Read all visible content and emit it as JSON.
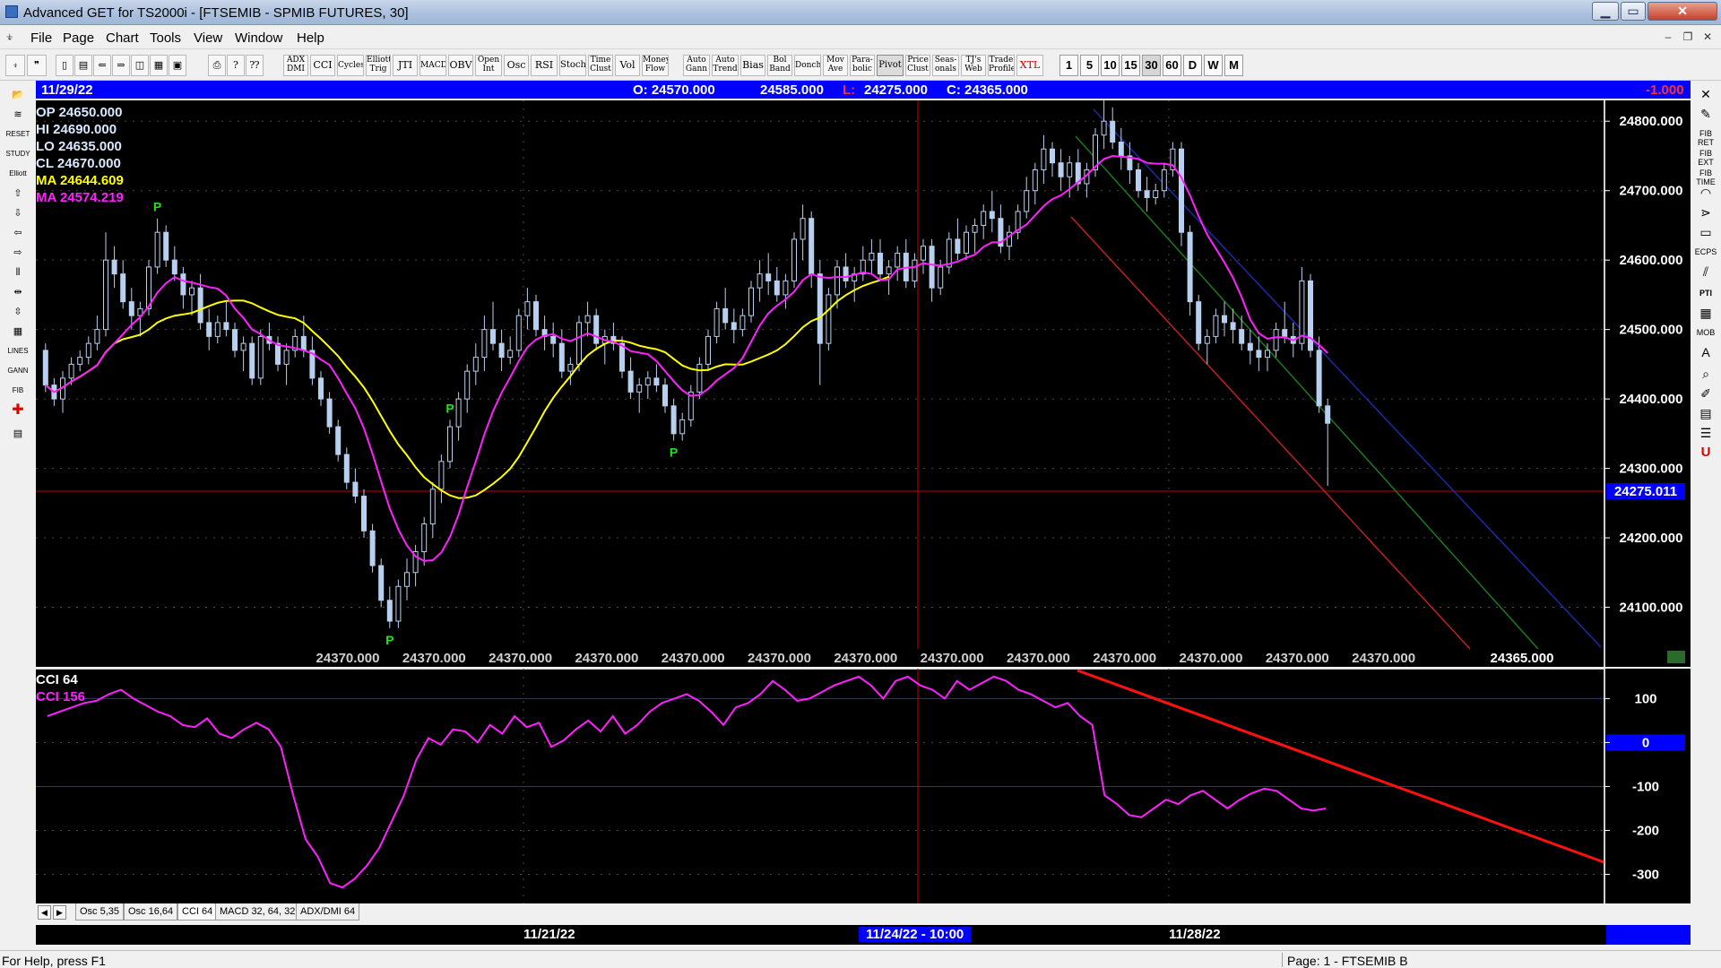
{
  "window": {
    "title": "Advanced GET for TS2000i - [FTSEMIB - SPMIB FUTURES, 30]",
    "min_glyph": "▁",
    "max_glyph": "▭",
    "close_glyph": "✕"
  },
  "menu": {
    "items": [
      "File",
      "Page",
      "Chart",
      "Tools",
      "View",
      "Window",
      "Help"
    ],
    "mdi_min": "‒",
    "mdi_restore": "❐",
    "mdi_close": "✕"
  },
  "toolbar": {
    "studies": [
      {
        "label": "ADX DMI"
      },
      {
        "label": "CCI"
      },
      {
        "label": "Cycles"
      },
      {
        "label": "Elliott Trig"
      },
      {
        "label": "JTI"
      },
      {
        "label": "MACD"
      },
      {
        "label": "OBV"
      },
      {
        "label": "Open Int"
      },
      {
        "label": "Osc"
      },
      {
        "label": "RSI"
      },
      {
        "label": "Stoch"
      },
      {
        "label": "Time Clust"
      },
      {
        "label": "Vol"
      },
      {
        "label": "Money Flow"
      }
    ],
    "studies2": [
      {
        "label": "Auto Gann"
      },
      {
        "label": "Auto Trend"
      },
      {
        "label": "Bias"
      },
      {
        "label": "Bol Band"
      },
      {
        "label": "Donch"
      },
      {
        "label": "Mov Ave"
      },
      {
        "label": "Para-bolic"
      },
      {
        "label": "Pivot"
      },
      {
        "label": "Price Clust"
      },
      {
        "label": "Seas-onals"
      },
      {
        "label": "TJ's Web"
      },
      {
        "label": "Trade Profile"
      },
      {
        "label": "XTL"
      }
    ],
    "timeframes": [
      "1",
      "5",
      "10",
      "15",
      "30",
      "60",
      "D",
      "W",
      "M"
    ],
    "selected_timeframe": "30"
  },
  "header_bar": {
    "date": "11/29/22",
    "open": "O: 24570.000",
    "high": "24585.000",
    "low_label": "L:",
    "low": "24275.000",
    "close": "C: 24365.000",
    "change": "-1.000"
  },
  "price_panel": {
    "readout": {
      "op": "OP  24650.000",
      "hi": "HI   24690.000",
      "lo": "LO  24635.000",
      "cl": "CL  24670.000",
      "ma1": "MA  24644.609",
      "ma2": "MA  24574.219"
    },
    "axis_labels": [
      "24800.000",
      "24700.000",
      "24600.000",
      "24500.000",
      "24400.000",
      "24300.000",
      "24200.000",
      "24100.000"
    ],
    "current_price": "24275.011",
    "bottom_values": [
      "24370.000",
      "24370.000",
      "24370.000",
      "24370.000",
      "24370.000",
      "24370.000",
      "24370.000",
      "24370.000",
      "24370.000",
      "24370.000",
      "24370.000",
      "24370.000",
      "24370.000"
    ],
    "bottom_last": "24365.000",
    "pivot_marker": "P"
  },
  "cci_panel": {
    "title": "CCI 64",
    "value_label": "CCI  156",
    "axis_labels": [
      "100",
      "0",
      "-100",
      "-200",
      "-300"
    ]
  },
  "tabs": [
    "Osc 5,35",
    "Osc 16,64",
    "CCI 64",
    "MACD 32, 64, 32",
    "ADX/DMI 64"
  ],
  "selected_tab": "CCI 64",
  "time_axis": {
    "labels": [
      "11/21/22",
      "11/24/22 - 10:00",
      "11/28/22"
    ]
  },
  "status": {
    "help": "For Help, press F1",
    "page": "Page: 1 - FTSEMIB B"
  },
  "chart_data": [
    {
      "type": "candlestick",
      "ylim": [
        24040,
        24830
      ],
      "bars": [
        [
          24470,
          24480,
          24410,
          24420
        ],
        [
          24420,
          24430,
          24390,
          24400
        ],
        [
          24400,
          24440,
          24380,
          24430
        ],
        [
          24430,
          24460,
          24420,
          24450
        ],
        [
          24450,
          24470,
          24440,
          24460
        ],
        [
          24460,
          24490,
          24450,
          24480
        ],
        [
          24480,
          24520,
          24470,
          24500
        ],
        [
          24500,
          24640,
          24490,
          24600
        ],
        [
          24600,
          24620,
          24560,
          24580
        ],
        [
          24580,
          24600,
          24530,
          24540
        ],
        [
          24540,
          24560,
          24500,
          24520
        ],
        [
          24520,
          24540,
          24490,
          24530
        ],
        [
          24530,
          24600,
          24520,
          24590
        ],
        [
          24590,
          24660,
          24580,
          24640
        ],
        [
          24640,
          24650,
          24590,
          24600
        ],
        [
          24600,
          24620,
          24570,
          24580
        ],
        [
          24580,
          24590,
          24530,
          24550
        ],
        [
          24550,
          24570,
          24520,
          24560
        ],
        [
          24560,
          24580,
          24500,
          24510
        ],
        [
          24510,
          24530,
          24470,
          24490
        ],
        [
          24490,
          24520,
          24480,
          24510
        ],
        [
          24510,
          24540,
          24490,
          24500
        ],
        [
          24500,
          24510,
          24460,
          24470
        ],
        [
          24470,
          24490,
          24440,
          24480
        ],
        [
          24480,
          24490,
          24420,
          24430
        ],
        [
          24430,
          24500,
          24420,
          24490
        ],
        [
          24490,
          24510,
          24470,
          24480
        ],
        [
          24480,
          24490,
          24440,
          24450
        ],
        [
          24450,
          24480,
          24420,
          24470
        ],
        [
          24470,
          24500,
          24460,
          24490
        ],
        [
          24490,
          24520,
          24460,
          24470
        ],
        [
          24470,
          24490,
          24420,
          24430
        ],
        [
          24430,
          24440,
          24390,
          24400
        ],
        [
          24400,
          24410,
          24350,
          24360
        ],
        [
          24360,
          24370,
          24310,
          24320
        ],
        [
          24320,
          24330,
          24270,
          24280
        ],
        [
          24280,
          24300,
          24250,
          24260
        ],
        [
          24260,
          24270,
          24200,
          24210
        ],
        [
          24210,
          24220,
          24150,
          24160
        ],
        [
          24160,
          24170,
          24100,
          24110
        ],
        [
          24110,
          24130,
          24070,
          24080
        ],
        [
          24080,
          24140,
          24070,
          24130
        ],
        [
          24130,
          24170,
          24110,
          24150
        ],
        [
          24150,
          24190,
          24130,
          24180
        ],
        [
          24180,
          24230,
          24160,
          24220
        ],
        [
          24220,
          24280,
          24200,
          24270
        ],
        [
          24270,
          24320,
          24250,
          24310
        ],
        [
          24310,
          24370,
          24300,
          24360
        ],
        [
          24360,
          24410,
          24340,
          24400
        ],
        [
          24400,
          24450,
          24380,
          24440
        ],
        [
          24440,
          24480,
          24420,
          24460
        ],
        [
          24460,
          24520,
          24440,
          24500
        ],
        [
          24500,
          24540,
          24470,
          24480
        ],
        [
          24480,
          24500,
          24440,
          24460
        ],
        [
          24460,
          24490,
          24450,
          24470
        ],
        [
          24470,
          24530,
          24460,
          24520
        ],
        [
          24520,
          24560,
          24500,
          24540
        ],
        [
          24540,
          24550,
          24490,
          24500
        ],
        [
          24500,
          24520,
          24470,
          24490
        ],
        [
          24490,
          24510,
          24460,
          24480
        ],
        [
          24480,
          24500,
          24430,
          24440
        ],
        [
          24440,
          24460,
          24420,
          24450
        ],
        [
          24450,
          24520,
          24440,
          24510
        ],
        [
          24510,
          24540,
          24490,
          24520
        ],
        [
          24520,
          24530,
          24470,
          24480
        ],
        [
          24480,
          24500,
          24450,
          24490
        ],
        [
          24490,
          24510,
          24470,
          24480
        ],
        [
          24480,
          24490,
          24430,
          24440
        ],
        [
          24440,
          24460,
          24400,
          24410
        ],
        [
          24410,
          24430,
          24380,
          24420
        ],
        [
          24420,
          24440,
          24400,
          24430
        ],
        [
          24430,
          24450,
          24410,
          24420
        ],
        [
          24420,
          24430,
          24380,
          24390
        ],
        [
          24390,
          24400,
          24340,
          24350
        ],
        [
          24350,
          24380,
          24340,
          24370
        ],
        [
          24370,
          24420,
          24360,
          24410
        ],
        [
          24410,
          24460,
          24400,
          24450
        ],
        [
          24450,
          24500,
          24440,
          24490
        ],
        [
          24490,
          24540,
          24480,
          24530
        ],
        [
          24530,
          24560,
          24500,
          24510
        ],
        [
          24510,
          24530,
          24480,
          24500
        ],
        [
          24500,
          24530,
          24490,
          24520
        ],
        [
          24520,
          24570,
          24510,
          24560
        ],
        [
          24560,
          24600,
          24540,
          24580
        ],
        [
          24580,
          24610,
          24550,
          24570
        ],
        [
          24570,
          24590,
          24540,
          24550
        ],
        [
          24550,
          24580,
          24530,
          24570
        ],
        [
          24570,
          24640,
          24560,
          24630
        ],
        [
          24630,
          24680,
          24600,
          24660
        ],
        [
          24660,
          24670,
          24560,
          24580
        ],
        [
          24580,
          24600,
          24420,
          24480
        ],
        [
          24480,
          24560,
          24470,
          24550
        ],
        [
          24550,
          24600,
          24530,
          24590
        ],
        [
          24590,
          24610,
          24560,
          24570
        ],
        [
          24570,
          24590,
          24540,
          24580
        ],
        [
          24580,
          24620,
          24570,
          24600
        ],
        [
          24600,
          24630,
          24580,
          24610
        ],
        [
          24610,
          24630,
          24570,
          24580
        ],
        [
          24580,
          24600,
          24550,
          24590
        ],
        [
          24590,
          24620,
          24570,
          24610
        ],
        [
          24610,
          24630,
          24560,
          24570
        ],
        [
          24570,
          24610,
          24560,
          24600
        ],
        [
          24600,
          24630,
          24580,
          24620
        ],
        [
          24620,
          24630,
          24540,
          24560
        ],
        [
          24560,
          24600,
          24550,
          24590
        ],
        [
          24590,
          24640,
          24580,
          24630
        ],
        [
          24630,
          24660,
          24600,
          24610
        ],
        [
          24610,
          24650,
          24600,
          24640
        ],
        [
          24640,
          24660,
          24610,
          24650
        ],
        [
          24650,
          24680,
          24630,
          24670
        ],
        [
          24670,
          24700,
          24640,
          24660
        ],
        [
          24660,
          24680,
          24610,
          24620
        ],
        [
          24620,
          24650,
          24600,
          24640
        ],
        [
          24640,
          24680,
          24630,
          24670
        ],
        [
          24670,
          24720,
          24660,
          24700
        ],
        [
          24700,
          24740,
          24680,
          24730
        ],
        [
          24730,
          24780,
          24710,
          24760
        ],
        [
          24760,
          24770,
          24720,
          24740
        ],
        [
          24740,
          24760,
          24700,
          24720
        ],
        [
          24720,
          24750,
          24690,
          24740
        ],
        [
          24740,
          24760,
          24700,
          24710
        ],
        [
          24710,
          24740,
          24690,
          24730
        ],
        [
          24730,
          24790,
          24720,
          24780
        ],
        [
          24780,
          24830,
          24760,
          24800
        ],
        [
          24800,
          24820,
          24760,
          24770
        ],
        [
          24770,
          24790,
          24730,
          24750
        ],
        [
          24750,
          24770,
          24710,
          24730
        ],
        [
          24730,
          24740,
          24690,
          24700
        ],
        [
          24700,
          24720,
          24670,
          24690
        ],
        [
          24690,
          24710,
          24680,
          24700
        ],
        [
          24700,
          24740,
          24690,
          24730
        ],
        [
          24730,
          24770,
          24720,
          24760
        ],
        [
          24760,
          24770,
          24620,
          24640
        ],
        [
          24640,
          24650,
          24520,
          24540
        ],
        [
          24540,
          24550,
          24470,
          24480
        ],
        [
          24480,
          24500,
          24450,
          24490
        ],
        [
          24490,
          24530,
          24480,
          24520
        ],
        [
          24520,
          24540,
          24490,
          24510
        ],
        [
          24510,
          24530,
          24480,
          24500
        ],
        [
          24500,
          24520,
          24470,
          24480
        ],
        [
          24480,
          24500,
          24450,
          24470
        ],
        [
          24470,
          24490,
          24440,
          24460
        ],
        [
          24460,
          24480,
          24440,
          24470
        ],
        [
          24470,
          24510,
          24460,
          24500
        ],
        [
          24500,
          24540,
          24480,
          24490
        ],
        [
          24490,
          24510,
          24460,
          24480
        ],
        [
          24480,
          24590,
          24470,
          24570
        ],
        [
          24570,
          24580,
          24460,
          24470
        ],
        [
          24470,
          24490,
          24380,
          24390
        ],
        [
          24390,
          24400,
          24275,
          24365
        ]
      ],
      "ma_fast": "yellow",
      "ma_slow": "magenta"
    },
    {
      "type": "line",
      "name": "CCI 64",
      "ylim": [
        -350,
        160
      ],
      "values": [
        60,
        70,
        80,
        90,
        95,
        110,
        120,
        100,
        85,
        70,
        60,
        40,
        35,
        55,
        20,
        10,
        30,
        45,
        30,
        -10,
        -120,
        -220,
        -260,
        -320,
        -330,
        -310,
        -280,
        -240,
        -180,
        -120,
        -40,
        10,
        -5,
        30,
        25,
        0,
        40,
        20,
        60,
        35,
        45,
        -10,
        5,
        30,
        50,
        25,
        60,
        20,
        40,
        70,
        90,
        100,
        110,
        95,
        70,
        40,
        80,
        90,
        110,
        140,
        120,
        95,
        100,
        115,
        130,
        140,
        150,
        130,
        100,
        140,
        150,
        130,
        120,
        100,
        140,
        120,
        135,
        150,
        140,
        120,
        110,
        95,
        80,
        90,
        60,
        40,
        -120,
        -140,
        -165,
        -170,
        -150,
        -130,
        -140,
        -120,
        -110,
        -130,
        -150,
        -130,
        -115,
        -105,
        -110,
        -130,
        -150,
        -155,
        -150
      ]
    }
  ]
}
